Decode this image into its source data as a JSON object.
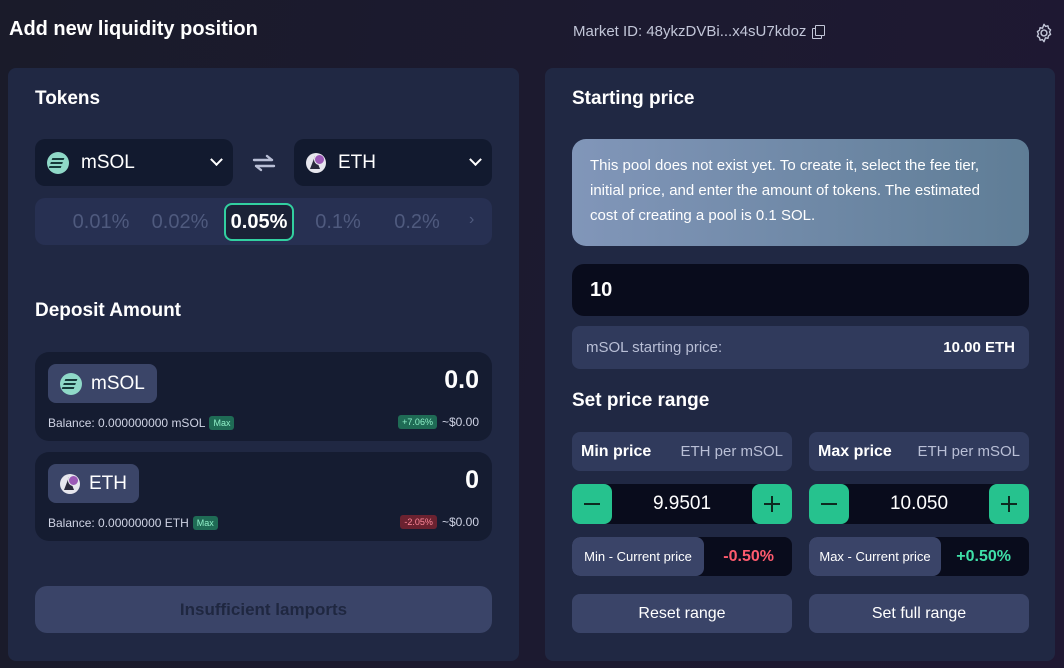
{
  "header": {
    "title": "Add new liquidity position",
    "market_id": "Market ID: 48ykzDVBi...x4sU7kdoz"
  },
  "tokens": {
    "heading": "Tokens",
    "token_a": "mSOL",
    "token_b": "ETH",
    "fee_tiers": [
      "0.01%",
      "0.02%",
      "0.05%",
      "0.1%",
      "0.2%"
    ],
    "selected_fee": "0.05%",
    "next_symbol": "›"
  },
  "deposit": {
    "heading": "Deposit Amount",
    "items": [
      {
        "token": "mSOL",
        "amount": "0.0",
        "balance": "Balance: 0.000000000 mSOL",
        "max": "Max",
        "change": "+7.06%",
        "usd": "~$0.00"
      },
      {
        "token": "ETH",
        "amount": "0",
        "balance": "Balance: 0.00000000 ETH",
        "max": "Max",
        "change": "-2.05%",
        "usd": "~$0.00"
      }
    ],
    "button": "Insufficient lamports"
  },
  "starting_price": {
    "heading": "Starting price",
    "notice": "This pool does not exist yet. To create it, select the fee tier, initial price, and enter the amount of tokens. The estimated cost of creating a pool is 0.1 SOL.",
    "input_value": "10",
    "label": "mSOL starting price:",
    "value": "10.00 ETH"
  },
  "range": {
    "heading": "Set price range",
    "min": {
      "title": "Min price",
      "unit": "ETH per mSOL",
      "value": "9.9501",
      "current_label": "Min - Current price",
      "current_value": "-0.50%"
    },
    "max": {
      "title": "Max price",
      "unit": "ETH per mSOL",
      "value": "10.050",
      "current_label": "Max - Current price",
      "current_value": "+0.50%"
    },
    "reset": "Reset range",
    "full": "Set full range"
  },
  "colors": {
    "accent": "#26c28e",
    "negative": "#ff5b6e",
    "positive": "#3fe0a8"
  }
}
